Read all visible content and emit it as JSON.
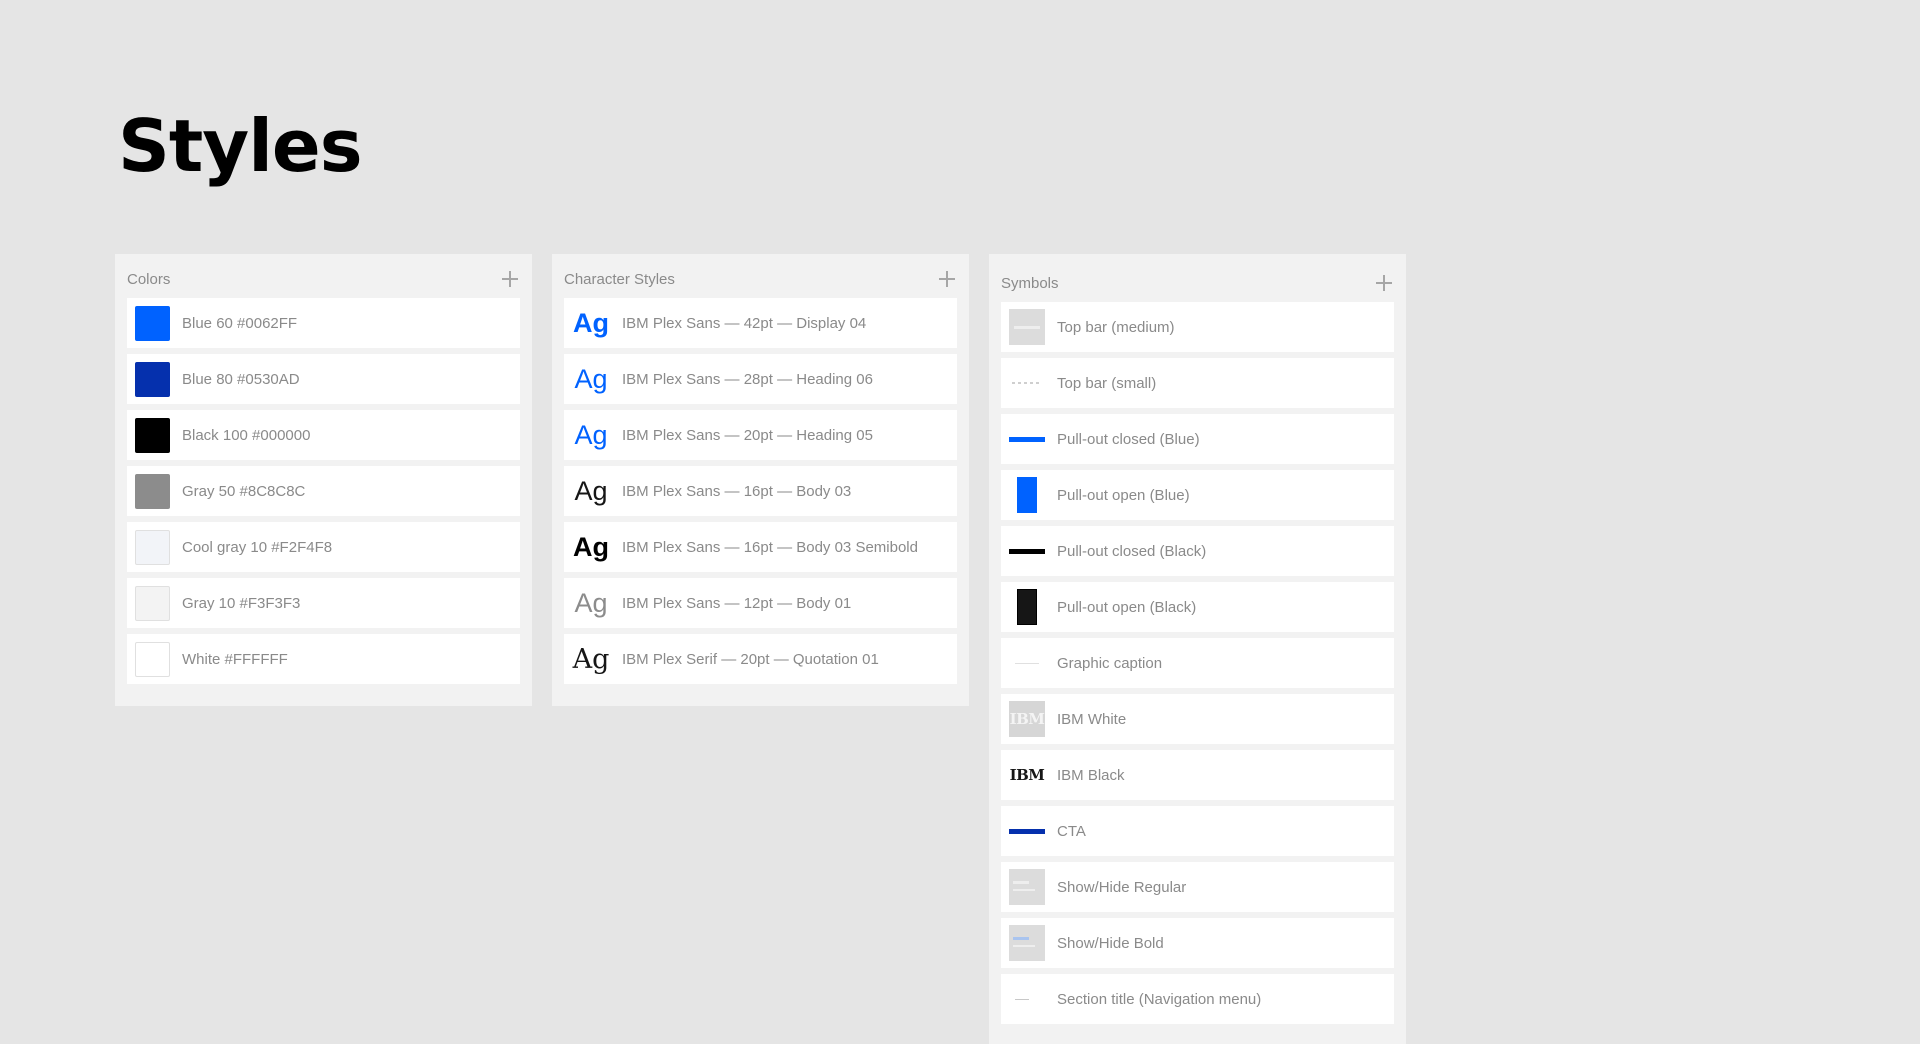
{
  "page": {
    "title": "Styles"
  },
  "colors": {
    "header": "Colors",
    "items": [
      {
        "label": "Blue 60 #0062FF",
        "swatch": "#0062FF"
      },
      {
        "label": "Blue 80 #0530AD",
        "swatch": "#0530AD"
      },
      {
        "label": "Black 100 #000000",
        "swatch": "#000000"
      },
      {
        "label": "Gray 50 #8C8C8C",
        "swatch": "#8C8C8C"
      },
      {
        "label": "Cool gray 10 #F2F4F8",
        "swatch": "#F2F4F8"
      },
      {
        "label": "Gray 10 #F3F3F3",
        "swatch": "#F3F3F3"
      },
      {
        "label": "White #FFFFFF",
        "swatch": "#FFFFFF"
      }
    ]
  },
  "character_styles": {
    "header": "Character Styles",
    "sample": "Ag",
    "items": [
      {
        "label": "IBM Plex Sans — 42pt — Display 04"
      },
      {
        "label": "IBM Plex Sans — 28pt — Heading 06"
      },
      {
        "label": "IBM Plex Sans — 20pt — Heading 05"
      },
      {
        "label": "IBM Plex Sans — 16pt — Body 03"
      },
      {
        "label": "IBM Plex Sans — 16pt — Body 03 Semibold"
      },
      {
        "label": "IBM Plex Sans — 12pt — Body 01"
      },
      {
        "label": "IBM Plex Serif — 20pt — Quotation 01"
      }
    ]
  },
  "symbols": {
    "header": "Symbols",
    "logo_text": "IBM",
    "items": [
      {
        "label": "Top bar (medium)"
      },
      {
        "label": "Top bar (small)"
      },
      {
        "label": "Pull-out closed (Blue)"
      },
      {
        "label": "Pull-out open (Blue)"
      },
      {
        "label": "Pull-out closed (Black)"
      },
      {
        "label": "Pull-out open (Black)"
      },
      {
        "label": "Graphic caption"
      },
      {
        "label": "IBM White"
      },
      {
        "label": "IBM Black"
      },
      {
        "label": "CTA"
      },
      {
        "label": "Show/Hide Regular"
      },
      {
        "label": "Show/Hide Bold"
      },
      {
        "label": "Section title (Navigation menu)"
      }
    ]
  },
  "icons": {
    "add": "plus-icon"
  }
}
